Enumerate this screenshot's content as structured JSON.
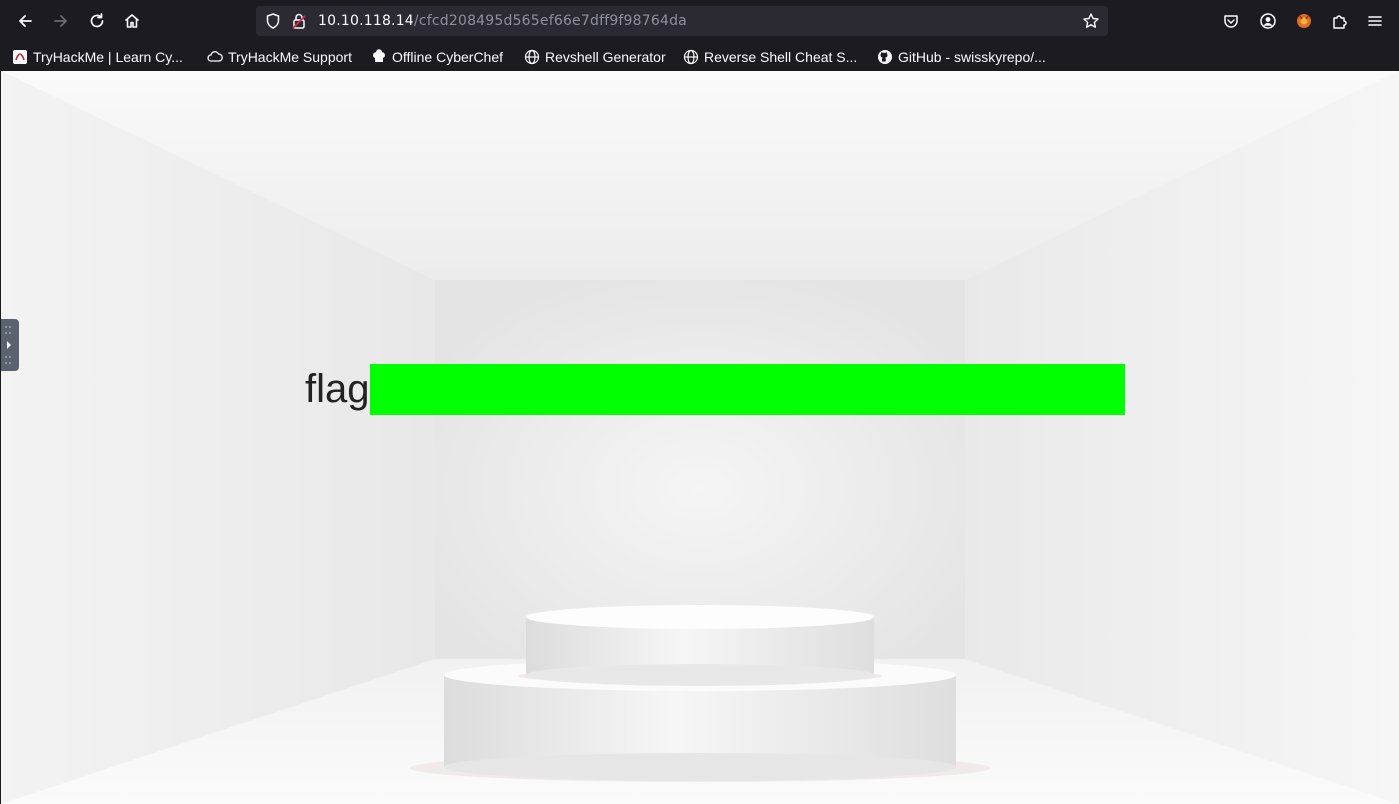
{
  "browser": {
    "url_host": "10.10.118.14",
    "url_path": "/cfcd208495d565ef66e7dff9f98764da",
    "bookmarks": [
      {
        "label": "TryHackMe | Learn Cy...",
        "icon": "tryhackme-icon"
      },
      {
        "label": "TryHackMe Support",
        "icon": "cloud-icon"
      },
      {
        "label": "Offline CyberChef",
        "icon": "chef-hat-icon"
      },
      {
        "label": "Revshell Generator",
        "icon": "globe-icon"
      },
      {
        "label": "Reverse Shell Cheat S...",
        "icon": "globe-icon"
      },
      {
        "label": "GitHub - swisskyrepo/...",
        "icon": "github-icon"
      }
    ]
  },
  "page": {
    "flag_label": "flag"
  },
  "colors": {
    "flag_box": "#00ff00",
    "toolbar": "#1c1b22"
  }
}
